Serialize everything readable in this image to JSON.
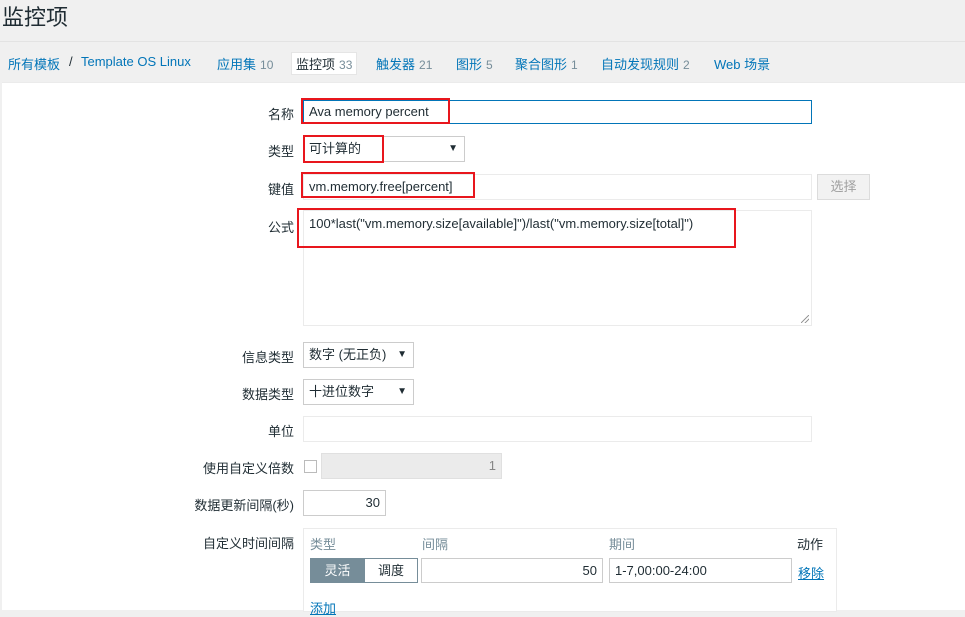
{
  "page": {
    "title": "监控项"
  },
  "nav": {
    "crumb_all_templates": "所有模板",
    "crumb_sep": "/",
    "crumb_template": "Template OS Linux",
    "tabs": [
      {
        "label": "应用集",
        "count": "10"
      },
      {
        "label": "监控项",
        "count": "33"
      },
      {
        "label": "触发器",
        "count": "21"
      },
      {
        "label": "图形",
        "count": "5"
      },
      {
        "label": "聚合图形",
        "count": "1"
      },
      {
        "label": "自动发现规则",
        "count": "2"
      },
      {
        "label": "Web 场景",
        "count": ""
      }
    ]
  },
  "form": {
    "name_label": "名称",
    "name_value": "Ava memory percent",
    "type_label": "类型",
    "type_value": "可计算的",
    "key_label": "键值",
    "key_value": "vm.memory.free[percent]",
    "select_button": "选择",
    "formula_label": "公式",
    "formula_value": "100*last(\"vm.memory.size[available]\")/last(\"vm.memory.size[total]\")",
    "info_type_label": "信息类型",
    "info_type_value": "数字 (无正负)",
    "data_type_label": "数据类型",
    "data_type_value": "十进位数字",
    "units_label": "单位",
    "units_value": "",
    "multiplier_label": "使用自定义倍数",
    "multiplier_value": "1",
    "update_interval_label": "数据更新间隔(秒)",
    "update_interval_value": "30",
    "custom_intervals_label": "自定义时间间隔",
    "intervals": {
      "col_type": "类型",
      "col_interval": "间隔",
      "col_period": "期间",
      "col_action": "动作",
      "flexible_label": "灵活",
      "scheduling_label": "调度",
      "interval_value": "50",
      "period_value": "1-7,00:00-24:00",
      "remove_label": "移除",
      "add_label": "添加"
    }
  },
  "colors": {
    "highlight_box": "#e8161d",
    "link": "#0275b8",
    "segment_active": "#768d99"
  }
}
